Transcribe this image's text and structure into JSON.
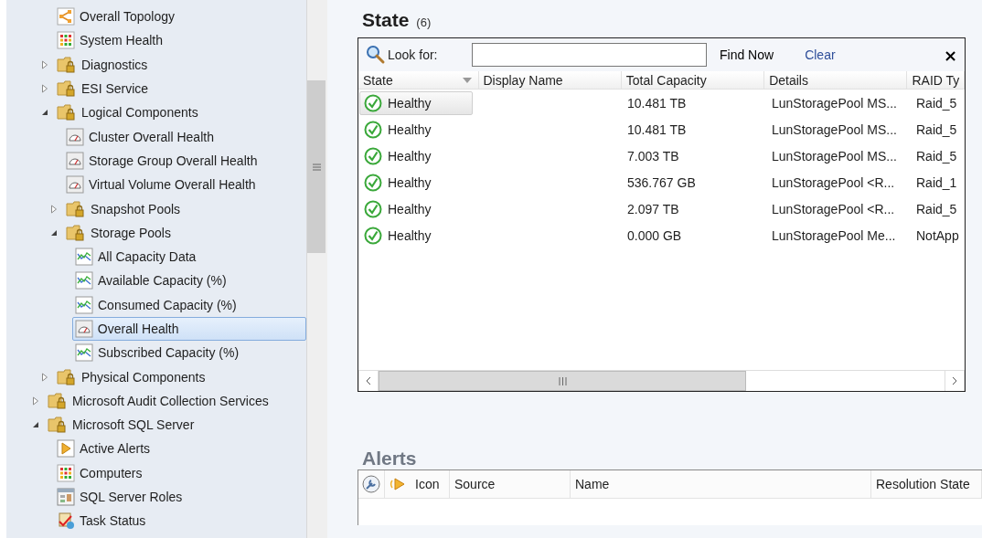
{
  "tree": {
    "continued_children": [
      {
        "label": "Overall Topology",
        "kind": "topology",
        "selected": false
      },
      {
        "label": "System Health",
        "kind": "grid",
        "selected": false
      },
      {
        "label": "Diagnostics",
        "kind": "folder",
        "expanded": false,
        "selected": false
      },
      {
        "label": "ESI Service",
        "kind": "folder",
        "expanded": false,
        "selected": false
      },
      {
        "label": "Logical Components",
        "kind": "folder",
        "expanded": true,
        "selected": false,
        "children": [
          {
            "label": "Cluster Overall Health",
            "kind": "gauge",
            "selected": false
          },
          {
            "label": "Storage Group Overall Health",
            "kind": "gauge",
            "selected": false
          },
          {
            "label": "Virtual Volume Overall Health",
            "kind": "gauge",
            "selected": false
          },
          {
            "label": "Snapshot Pools",
            "kind": "folder",
            "expanded": false,
            "selected": false
          },
          {
            "label": "Storage Pools",
            "kind": "folder",
            "expanded": true,
            "selected": false,
            "children": [
              {
                "label": "All Capacity Data",
                "kind": "chart",
                "selected": false
              },
              {
                "label": "Available Capacity (%)",
                "kind": "chart",
                "selected": false
              },
              {
                "label": "Consumed Capacity (%)",
                "kind": "chart",
                "selected": false
              },
              {
                "label": "Overall Health",
                "kind": "gauge",
                "selected": true
              },
              {
                "label": "Subscribed Capacity (%)",
                "kind": "chart",
                "selected": false
              }
            ]
          }
        ]
      },
      {
        "label": "Physical Components",
        "kind": "folder",
        "expanded": false,
        "selected": false
      }
    ],
    "items": [
      {
        "label": "Microsoft Audit Collection Services",
        "kind": "folder",
        "expanded": false,
        "selected": false
      },
      {
        "label": "Microsoft SQL Server",
        "kind": "folder",
        "expanded": true,
        "selected": false,
        "children": [
          {
            "label": "Active Alerts",
            "kind": "alert",
            "selected": false
          },
          {
            "label": "Computers",
            "kind": "grid",
            "selected": false
          },
          {
            "label": "SQL Server Roles",
            "kind": "roles",
            "selected": false
          },
          {
            "label": "Task Status",
            "kind": "task",
            "selected": false
          }
        ]
      }
    ]
  },
  "state": {
    "title": "State",
    "count": "(6)",
    "search": {
      "label": "Look for:",
      "find": "Find Now",
      "clear": "Clear",
      "close": "×"
    },
    "columns": [
      "State",
      "Display Name",
      "Total Capacity",
      "Details",
      "RAID Ty"
    ],
    "rows": [
      {
        "state": "Healthy",
        "capacity": "10.481 TB",
        "details": "LunStoragePool MS...",
        "raid": "Raid_5",
        "selected": true
      },
      {
        "state": "Healthy",
        "capacity": "10.481 TB",
        "details": "LunStoragePool MS...",
        "raid": "Raid_5",
        "selected": false
      },
      {
        "state": "Healthy",
        "capacity": "7.003 TB",
        "details": "LunStoragePool MS...",
        "raid": "Raid_5",
        "selected": false
      },
      {
        "state": "Healthy",
        "capacity": "536.767 GB",
        "details": "LunStoragePool <R...",
        "raid": "Raid_1",
        "selected": false
      },
      {
        "state": "Healthy",
        "capacity": "2.097 TB",
        "details": "LunStoragePool <R...",
        "raid": "Raid_5",
        "selected": false
      },
      {
        "state": "Healthy",
        "capacity": "0.000 GB",
        "details": "LunStoragePool Me...",
        "raid": "NotApp",
        "selected": false
      }
    ]
  },
  "alerts": {
    "title": "Alerts",
    "columns": [
      "Icon",
      "Source",
      "Name",
      "Resolution State"
    ]
  }
}
